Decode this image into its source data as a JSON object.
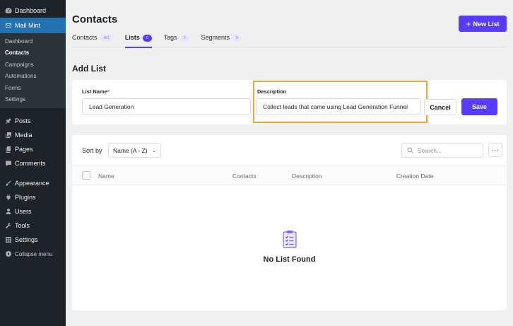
{
  "sidebar": {
    "top_items": [
      {
        "label": "Dashboard",
        "icon": "dashboard-icon"
      },
      {
        "label": "Mail Mint",
        "icon": "mail-icon"
      }
    ],
    "submenu": [
      "Dashboard",
      "Contacts",
      "Campaigns",
      "Automations",
      "Forms",
      "Settings"
    ],
    "current_submenu": "Contacts",
    "items_group1": [
      {
        "label": "Posts",
        "icon": "pin-icon"
      },
      {
        "label": "Media",
        "icon": "media-icon"
      },
      {
        "label": "Pages",
        "icon": "pages-icon"
      },
      {
        "label": "Comments",
        "icon": "comments-icon"
      }
    ],
    "items_group2": [
      {
        "label": "Appearance",
        "icon": "brush-icon"
      },
      {
        "label": "Plugins",
        "icon": "plugin-icon"
      },
      {
        "label": "Users",
        "icon": "users-icon"
      },
      {
        "label": "Tools",
        "icon": "wrench-icon"
      },
      {
        "label": "Settings",
        "icon": "settings-icon"
      },
      {
        "label": "Collapse menu",
        "icon": "collapse-icon"
      }
    ]
  },
  "header": {
    "title": "Contacts",
    "new_list_label": "New List"
  },
  "tabs": [
    {
      "label": "Contacts",
      "count": "461"
    },
    {
      "label": "Lists",
      "count": "0"
    },
    {
      "label": "Tags",
      "count": "3"
    },
    {
      "label": "Segments",
      "count": "0"
    }
  ],
  "add_list": {
    "section_title": "Add List",
    "list_name_label": "List Name",
    "required_mark": "*",
    "list_name_value": "Lead Generation",
    "description_label": "Description",
    "description_value": "Collect leads that came using Lead Generation Funnel",
    "cancel_label": "Cancel",
    "save_label": "Save"
  },
  "list_table": {
    "sort_label": "Sort by",
    "sort_value": "Name (A - Z)",
    "search_placeholder": "Search...",
    "more_label": "···",
    "columns": [
      "Name",
      "Contacts",
      "Description",
      "Creation Date"
    ],
    "empty_text": "No List Found"
  },
  "colors": {
    "accent": "#573bff",
    "highlight": "#f5a22f",
    "sidebar_bg": "#1d2327",
    "sidebar_active": "#2271b1"
  }
}
